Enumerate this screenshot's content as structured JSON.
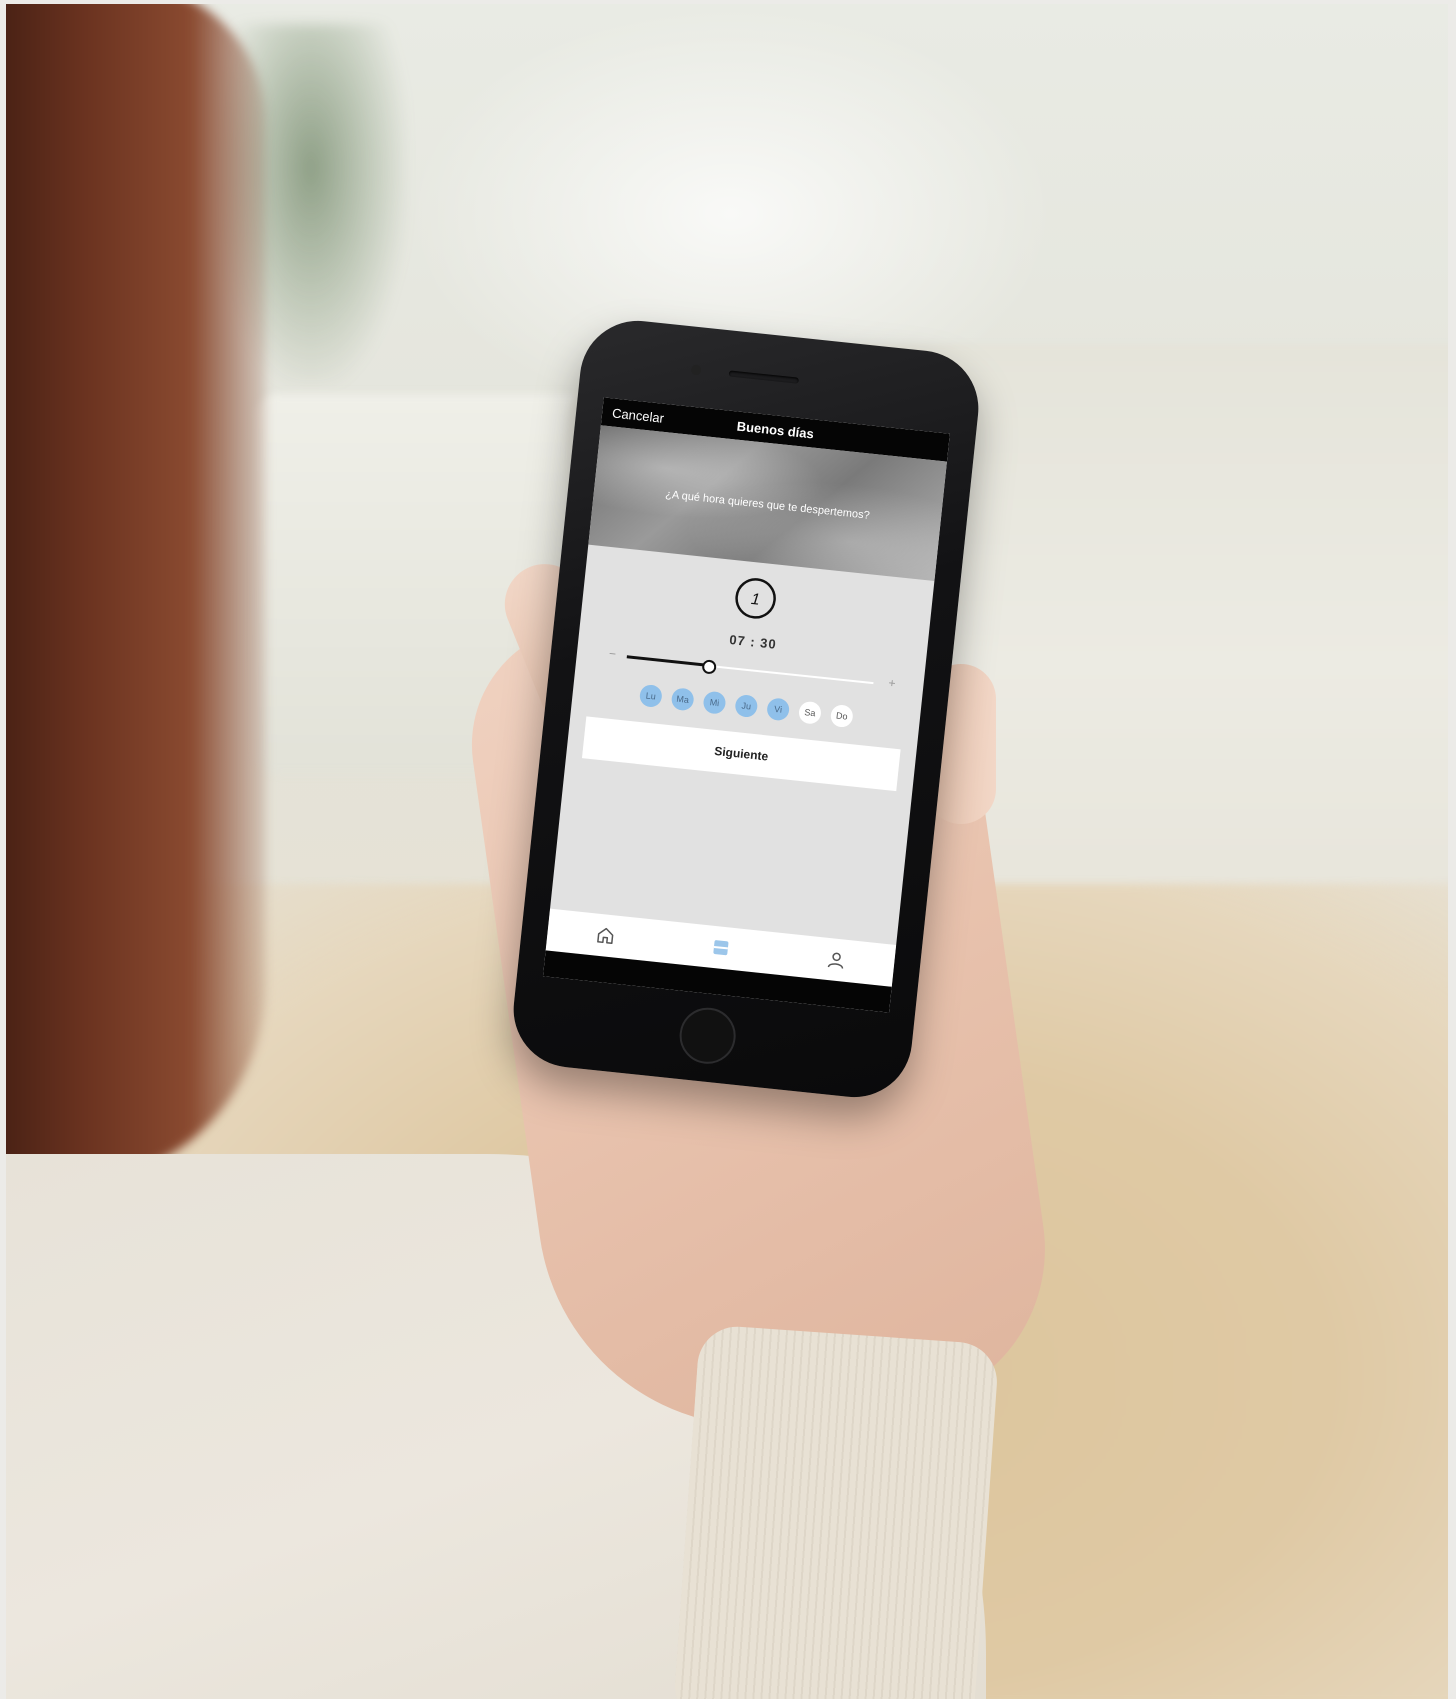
{
  "app": {
    "title": "Buenos días",
    "cancel_label": "Cancelar"
  },
  "hero": {
    "question": "¿A qué hora quieres que te despertemos?"
  },
  "alarm": {
    "clock_glyph": "1",
    "time": "07 : 30",
    "slider_fraction": 0.33,
    "minus_label": "−",
    "plus_label": "+"
  },
  "days": [
    {
      "label": "Lu",
      "selected": true
    },
    {
      "label": "Ma",
      "selected": true
    },
    {
      "label": "Mi",
      "selected": true
    },
    {
      "label": "Ju",
      "selected": true
    },
    {
      "label": "Vi",
      "selected": true
    },
    {
      "label": "Sa",
      "selected": false
    },
    {
      "label": "Do",
      "selected": false
    }
  ],
  "next_label": "Siguiente",
  "tabbar": {
    "items": [
      {
        "icon": "home-icon",
        "active": false
      },
      {
        "icon": "schedule-icon",
        "active": true
      },
      {
        "icon": "profile-icon",
        "active": false
      }
    ]
  },
  "colors": {
    "day_selected": "#8fc0ea",
    "accent_tab": "#9cc6ea"
  }
}
